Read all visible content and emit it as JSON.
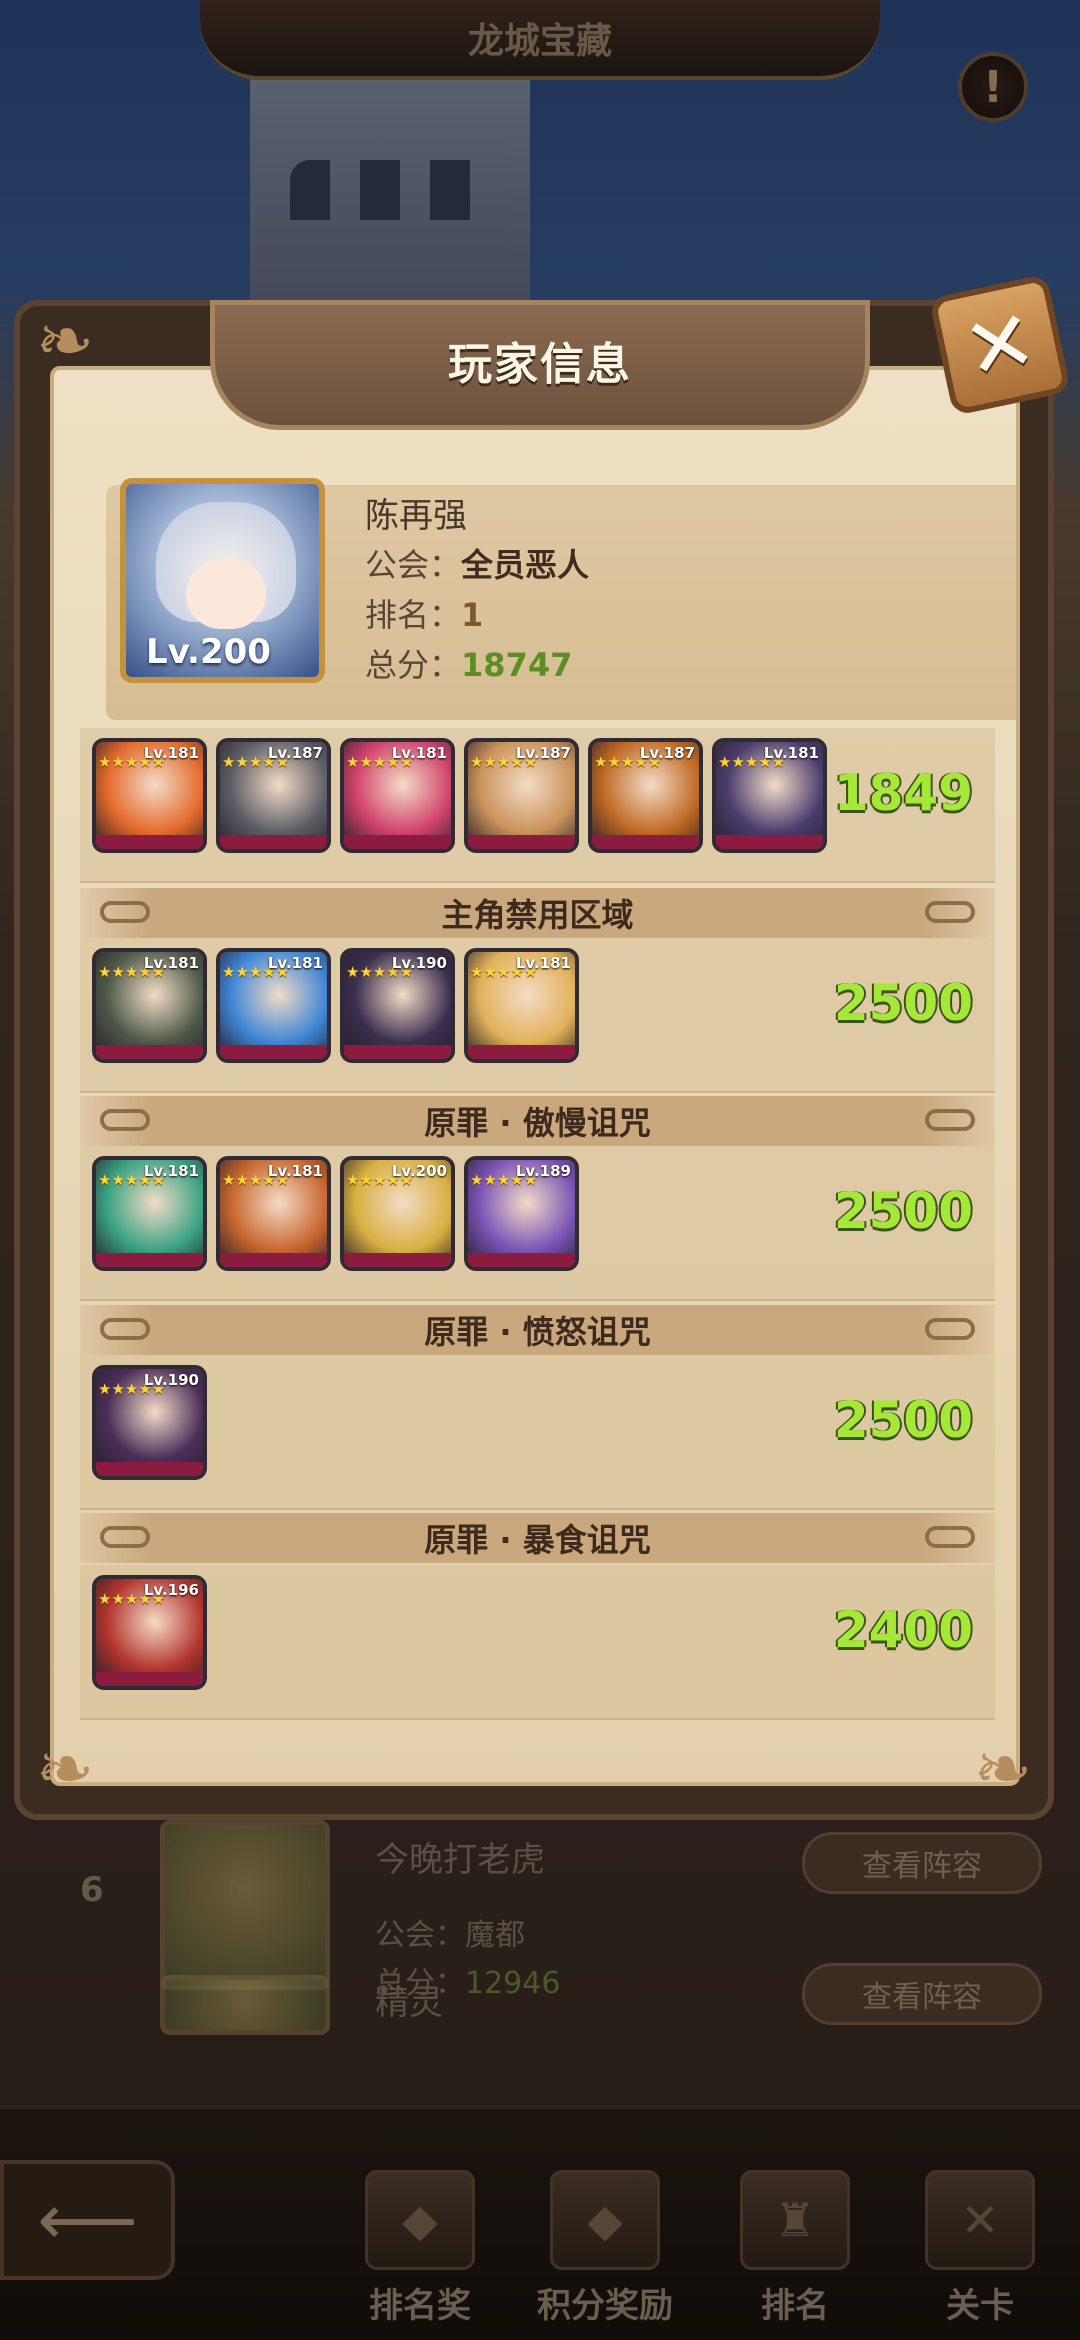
{
  "header": {
    "title": "龙城宝藏"
  },
  "modal": {
    "title": "玩家信息",
    "close_icon": "close-x-icon",
    "player": {
      "name": "陈再强",
      "level_text": "Lv.200",
      "guild_label": "公会：",
      "guild": "全员恶人",
      "rank_label": "排名：",
      "rank": "1",
      "score_label": "总分：",
      "score": "18747"
    },
    "sections": [
      {
        "title": "",
        "score": "1849",
        "heroes": [
          {
            "lv": "Lv.181",
            "color": "#e46a2c"
          },
          {
            "lv": "Lv.187",
            "color": "#5d5f66"
          },
          {
            "lv": "Lv.181",
            "color": "#d0436b"
          },
          {
            "lv": "Lv.187",
            "color": "#c9925a"
          },
          {
            "lv": "Lv.187",
            "color": "#c06a24"
          },
          {
            "lv": "Lv.181",
            "color": "#4a3d6e"
          }
        ]
      },
      {
        "title": "主角禁用区域",
        "score": "2500",
        "heroes": [
          {
            "lv": "Lv.181",
            "color": "#4e5a4a"
          },
          {
            "lv": "Lv.181",
            "color": "#3f87d6"
          },
          {
            "lv": "Lv.190",
            "color": "#3b2f4f"
          },
          {
            "lv": "Lv.181",
            "color": "#e2b25a"
          }
        ]
      },
      {
        "title": "原罪 · 傲慢诅咒",
        "score": "2500",
        "heroes": [
          {
            "lv": "Lv.181",
            "color": "#3aa383"
          },
          {
            "lv": "Lv.181",
            "color": "#c8672f"
          },
          {
            "lv": "Lv.200",
            "color": "#d8b040"
          },
          {
            "lv": "Lv.189",
            "color": "#7b54b6"
          }
        ]
      },
      {
        "title": "原罪 · 愤怒诅咒",
        "score": "2500",
        "heroes": [
          {
            "lv": "Lv.190",
            "color": "#4b2e58"
          }
        ]
      },
      {
        "title": "原罪 · 暴食诅咒",
        "score": "2400",
        "heroes": [
          {
            "lv": "Lv.196",
            "color": "#b3352e"
          }
        ]
      }
    ]
  },
  "background_list": [
    {
      "rank": "6",
      "name": "今晚打老虎",
      "guild_label": "公会：",
      "guild": "魔都",
      "score_label": "总分：",
      "score": "12946",
      "button": "查看阵容"
    },
    {
      "rank": "",
      "name": "精灵",
      "guild_label": "",
      "guild": "",
      "score_label": "",
      "score": "",
      "button": "查看阵容"
    }
  ],
  "bottom_nav": {
    "back_icon": "back-arrow-icon",
    "items": [
      {
        "label": "排名奖",
        "icon": "rank-reward-icon"
      },
      {
        "label": "积分奖励",
        "icon": "points-reward-icon"
      },
      {
        "label": "排名",
        "icon": "ranking-icon"
      },
      {
        "label": "关卡",
        "icon": "stage-icon"
      }
    ]
  },
  "colors": {
    "score_green": "#a5e838",
    "parchment": "#eee0c4",
    "frame_brown": "#3b2c22"
  }
}
